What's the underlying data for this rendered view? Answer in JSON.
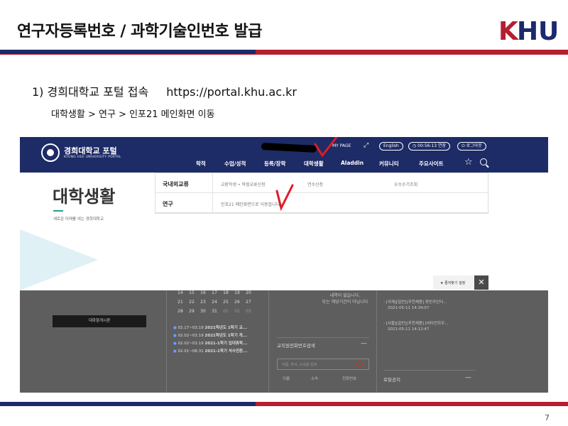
{
  "slide": {
    "title": "연구자등록번호 / 과학기술인번호 발급",
    "logo_text": "KHU",
    "step": "1) 경희대학교 포털 접속",
    "url": "https://portal.khu.ac.kr",
    "path": "대학생활 > 연구 > 인포21 메인화면 이동",
    "page_number": "7"
  },
  "colors": {
    "navy": "#1c2a6b",
    "red": "#b51f2e",
    "portal_nav": "#1d2b66",
    "checkmark": "#e01b24"
  },
  "portal": {
    "brand_ko": "경희대학교 포털",
    "brand_en": "KYUNG HEE UNIVERSITY PORTAL",
    "util": {
      "mypage": "MY PAGE",
      "lang": "English",
      "timer": "00:56:13  연장",
      "logout": "로그아웃"
    },
    "menu": [
      "학적",
      "수업/성적",
      "등록/장학",
      "대학생활",
      "Aladdin",
      "커뮤니티",
      "주요사이트"
    ],
    "hero_title": "대학생활",
    "hero_sub": "새로운 미래를 여는 경희대학교",
    "dropdown": [
      {
        "category": "국내외교류",
        "items": [
          "교환학생 • 학점교류신청",
          "연수신청",
          "우수수기조회"
        ]
      },
      {
        "category": "연구",
        "items": [
          "인포21 메인화면으로 이동합니다"
        ]
      }
    ],
    "quick_box": "즐겨찾기 설정",
    "calendar": [
      [
        "14",
        "15",
        "16",
        "17",
        "18",
        "19",
        "20"
      ],
      [
        "21",
        "22",
        "23",
        "24",
        "25",
        "26",
        "27"
      ],
      [
        "28",
        "29",
        "30",
        "31",
        "01",
        "02",
        "03"
      ]
    ],
    "news": [
      {
        "date": "02.17~03.19",
        "text": "2021학년도 1학기 교..."
      },
      {
        "date": "02.02~03.19",
        "text": "2021학년도 1학기 개..."
      },
      {
        "date": "02.02~03.19",
        "text": "2021-1학기 입대휴학..."
      },
      {
        "date": "02.01~08.31",
        "text": "2021-1학기 석사전환..."
      }
    ],
    "bulletin_button": "대화형게시판",
    "notice_center": [
      "내역이 없습니다.",
      "또는 해당기간이 아닙니다"
    ],
    "right_list": [
      "- [국제][일반][추천채용] 류빈카인터...",
      "2021-05-11 14:34:07",
      "",
      "- [서울][일반][추천채용] [비타민하우...",
      "2021-05-11 14:12:47"
    ],
    "phone_search": {
      "title": "교직원전화번호검색",
      "placeholder": "이름, 부서, 소속을 입력",
      "columns": [
        "이름",
        "소속",
        "전화번호"
      ]
    },
    "portal_notice": "포탈공지"
  }
}
